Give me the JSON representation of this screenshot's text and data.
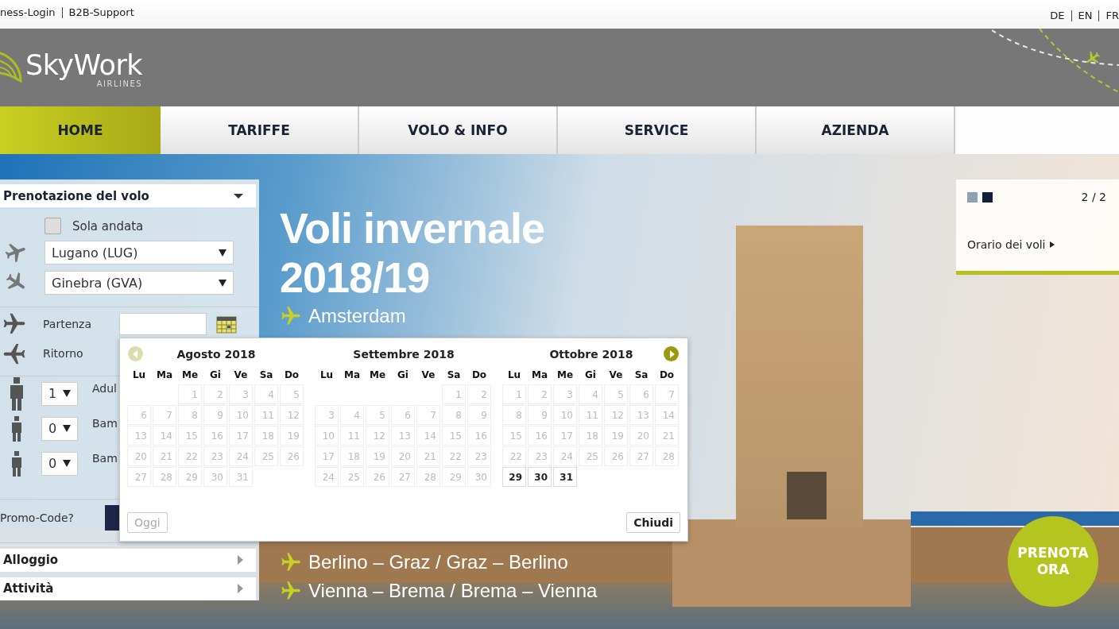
{
  "top_links": {
    "left": [
      "ness-Login",
      "B2B-Support"
    ],
    "languages": [
      "DE",
      "EN",
      "FR"
    ]
  },
  "header": {
    "logo": "SkyWork",
    "logo_sub": "AIRLINES"
  },
  "nav": [
    {
      "label": "HOME",
      "selected": true
    },
    {
      "label": "TARIFFE",
      "selected": false
    },
    {
      "label": "VOLO & INFO",
      "selected": false
    },
    {
      "label": "SERVICE",
      "selected": false
    },
    {
      "label": "AZIENDA",
      "selected": false
    }
  ],
  "booking": {
    "title": "Prenotazione del volo",
    "one_way": {
      "label": "Sola andata",
      "checked": false
    },
    "from": "Lugano (LUG)",
    "to": "Ginebra (GVA)",
    "departure_label": "Partenza",
    "return_label": "Ritorno",
    "passengers": [
      {
        "kind": "adult",
        "count": "1",
        "label": "Adul"
      },
      {
        "kind": "child",
        "count": "0",
        "label": "Bam"
      },
      {
        "kind": "child",
        "count": "0",
        "label": "Bam"
      }
    ],
    "promo_label": "Promo-Code?",
    "sections": [
      "Alloggio",
      "Attività"
    ]
  },
  "hero": {
    "headline": [
      "Voli invernale",
      "2018/19"
    ],
    "routes_top": [
      "Amsterdam"
    ],
    "routes_bottom": [
      "Berlino – Graz / Graz – Berlino",
      "Vienna – Brema / Brema – Vienna"
    ],
    "cta": "PRENOTA ORA"
  },
  "slider": {
    "dots": [
      {
        "selected": false
      },
      {
        "selected": true
      }
    ],
    "counter": "2 / 2",
    "link": "Orario dei voli"
  },
  "calendar": {
    "prev": {
      "disabled": true
    },
    "next": {
      "disabled": false
    },
    "months": [
      {
        "title": "Agosto 2018",
        "weekdays": [
          "Lu",
          "Ma",
          "Me",
          "Gi",
          "Ve",
          "Sa",
          "Do"
        ],
        "days": [
          {
            "day": "1",
            "disabled": true
          },
          {
            "day": "2",
            "disabled": true
          },
          {
            "day": "3",
            "disabled": true
          },
          {
            "day": "4",
            "disabled": true
          },
          {
            "day": "5",
            "disabled": true
          },
          {
            "day": "6",
            "disabled": true
          },
          {
            "day": "7",
            "disabled": true
          },
          {
            "day": "8",
            "disabled": true
          },
          {
            "day": "9",
            "disabled": true
          },
          {
            "day": "10",
            "disabled": true
          },
          {
            "day": "11",
            "disabled": true
          },
          {
            "day": "12",
            "disabled": true
          },
          {
            "day": "13",
            "disabled": true
          },
          {
            "day": "14",
            "disabled": true
          },
          {
            "day": "15",
            "disabled": true
          },
          {
            "day": "16",
            "disabled": true
          },
          {
            "day": "17",
            "disabled": true
          },
          {
            "day": "18",
            "disabled": true
          },
          {
            "day": "19",
            "disabled": true
          },
          {
            "day": "20",
            "disabled": true
          },
          {
            "day": "21",
            "disabled": true
          },
          {
            "day": "22",
            "disabled": true
          },
          {
            "day": "23",
            "disabled": true
          },
          {
            "day": "24",
            "disabled": true
          },
          {
            "day": "25",
            "disabled": true
          },
          {
            "day": "26",
            "disabled": true
          },
          {
            "day": "27",
            "disabled": true
          },
          {
            "day": "28",
            "disabled": true
          },
          {
            "day": "29",
            "disabled": true
          },
          {
            "day": "30",
            "disabled": true
          },
          {
            "day": "31",
            "disabled": true
          }
        ]
      },
      {
        "title": "Settembre 2018",
        "weekdays": [
          "Lu",
          "Ma",
          "Me",
          "Gi",
          "Ve",
          "Sa",
          "Do"
        ],
        "days": [
          {
            "day": "1",
            "disabled": true
          },
          {
            "day": "2",
            "disabled": true
          },
          {
            "day": "3",
            "disabled": true
          },
          {
            "day": "4",
            "disabled": true
          },
          {
            "day": "5",
            "disabled": true
          },
          {
            "day": "6",
            "disabled": true
          },
          {
            "day": "7",
            "disabled": true
          },
          {
            "day": "8",
            "disabled": true
          },
          {
            "day": "9",
            "disabled": true
          },
          {
            "day": "10",
            "disabled": true
          },
          {
            "day": "11",
            "disabled": true
          },
          {
            "day": "12",
            "disabled": true
          },
          {
            "day": "13",
            "disabled": true
          },
          {
            "day": "14",
            "disabled": true
          },
          {
            "day": "15",
            "disabled": true
          },
          {
            "day": "16",
            "disabled": true
          },
          {
            "day": "17",
            "disabled": true
          },
          {
            "day": "18",
            "disabled": true
          },
          {
            "day": "19",
            "disabled": true
          },
          {
            "day": "20",
            "disabled": true
          },
          {
            "day": "21",
            "disabled": true
          },
          {
            "day": "22",
            "disabled": true
          },
          {
            "day": "23",
            "disabled": true
          },
          {
            "day": "24",
            "disabled": true
          },
          {
            "day": "25",
            "disabled": true
          },
          {
            "day": "26",
            "disabled": true
          },
          {
            "day": "27",
            "disabled": true
          },
          {
            "day": "28",
            "disabled": true
          },
          {
            "day": "29",
            "disabled": true
          },
          {
            "day": "30",
            "disabled": true
          }
        ]
      },
      {
        "title": "Ottobre 2018",
        "weekdays": [
          "Lu",
          "Ma",
          "Me",
          "Gi",
          "Ve",
          "Sa",
          "Do"
        ],
        "days": [
          {
            "day": "1",
            "disabled": true
          },
          {
            "day": "2",
            "disabled": true
          },
          {
            "day": "3",
            "disabled": true
          },
          {
            "day": "4",
            "disabled": true
          },
          {
            "day": "5",
            "disabled": true
          },
          {
            "day": "6",
            "disabled": true
          },
          {
            "day": "7",
            "disabled": true
          },
          {
            "day": "8",
            "disabled": true
          },
          {
            "day": "9",
            "disabled": true
          },
          {
            "day": "10",
            "disabled": true
          },
          {
            "day": "11",
            "disabled": true
          },
          {
            "day": "12",
            "disabled": true
          },
          {
            "day": "13",
            "disabled": true
          },
          {
            "day": "14",
            "disabled": true
          },
          {
            "day": "15",
            "disabled": true
          },
          {
            "day": "16",
            "disabled": true
          },
          {
            "day": "17",
            "disabled": true
          },
          {
            "day": "18",
            "disabled": true
          },
          {
            "day": "19",
            "disabled": true
          },
          {
            "day": "20",
            "disabled": true
          },
          {
            "day": "21",
            "disabled": true
          },
          {
            "day": "22",
            "disabled": true
          },
          {
            "day": "23",
            "disabled": true
          },
          {
            "day": "24",
            "disabled": true
          },
          {
            "day": "25",
            "disabled": true
          },
          {
            "day": "26",
            "disabled": true
          },
          {
            "day": "27",
            "disabled": true
          },
          {
            "day": "28",
            "disabled": true
          },
          {
            "day": "29",
            "disabled": false
          },
          {
            "day": "30",
            "disabled": false
          },
          {
            "day": "31",
            "disabled": false
          }
        ]
      }
    ],
    "buttons": [
      {
        "label": "Oggi",
        "disabled": true
      },
      {
        "label": "Chiudi",
        "disabled": false
      }
    ]
  }
}
